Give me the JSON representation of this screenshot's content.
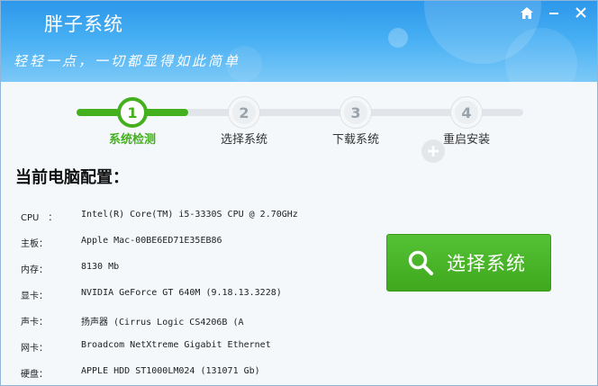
{
  "app": {
    "title": "胖子系统",
    "slogan": "轻轻一点，一切都显得如此简单"
  },
  "window_controls": {
    "home_icon": "home-icon",
    "minimize_icon": "minimize-icon",
    "close_icon": "close-icon"
  },
  "steps": [
    {
      "number": "1",
      "label": "系统检测",
      "active": true
    },
    {
      "number": "2",
      "label": "选择系统",
      "active": false
    },
    {
      "number": "3",
      "label": "下载系统",
      "active": false
    },
    {
      "number": "4",
      "label": "重启安装",
      "active": false
    }
  ],
  "progress": {
    "completed_fraction": 0.25
  },
  "section": {
    "title": "当前电脑配置："
  },
  "specs": [
    {
      "key": "CPU　：",
      "value": "Intel(R) Core(TM) i5-3330S CPU @ 2.70GHz"
    },
    {
      "key": "主板：",
      "value": "Apple Mac-00BE6ED71E35EB86"
    },
    {
      "key": "内存：",
      "value": "8130 Mb"
    },
    {
      "key": "显卡：",
      "value": "NVIDIA GeForce GT 640M (9.18.13.3228)"
    },
    {
      "key": "声卡：",
      "value": "扬声器 (Cirrus Logic CS4206B (A"
    },
    {
      "key": "网卡：",
      "value": "Broadcom NetXtreme Gigabit Ethernet"
    },
    {
      "key": "硬盘：",
      "value": "APPLE HDD ST1000LM024 (131071 Gb)"
    }
  ],
  "choose_button": {
    "label": "选择系统",
    "icon": "search-icon"
  },
  "colors": {
    "accent_green": "#44b01d",
    "header_blue": "#2d97ea"
  }
}
